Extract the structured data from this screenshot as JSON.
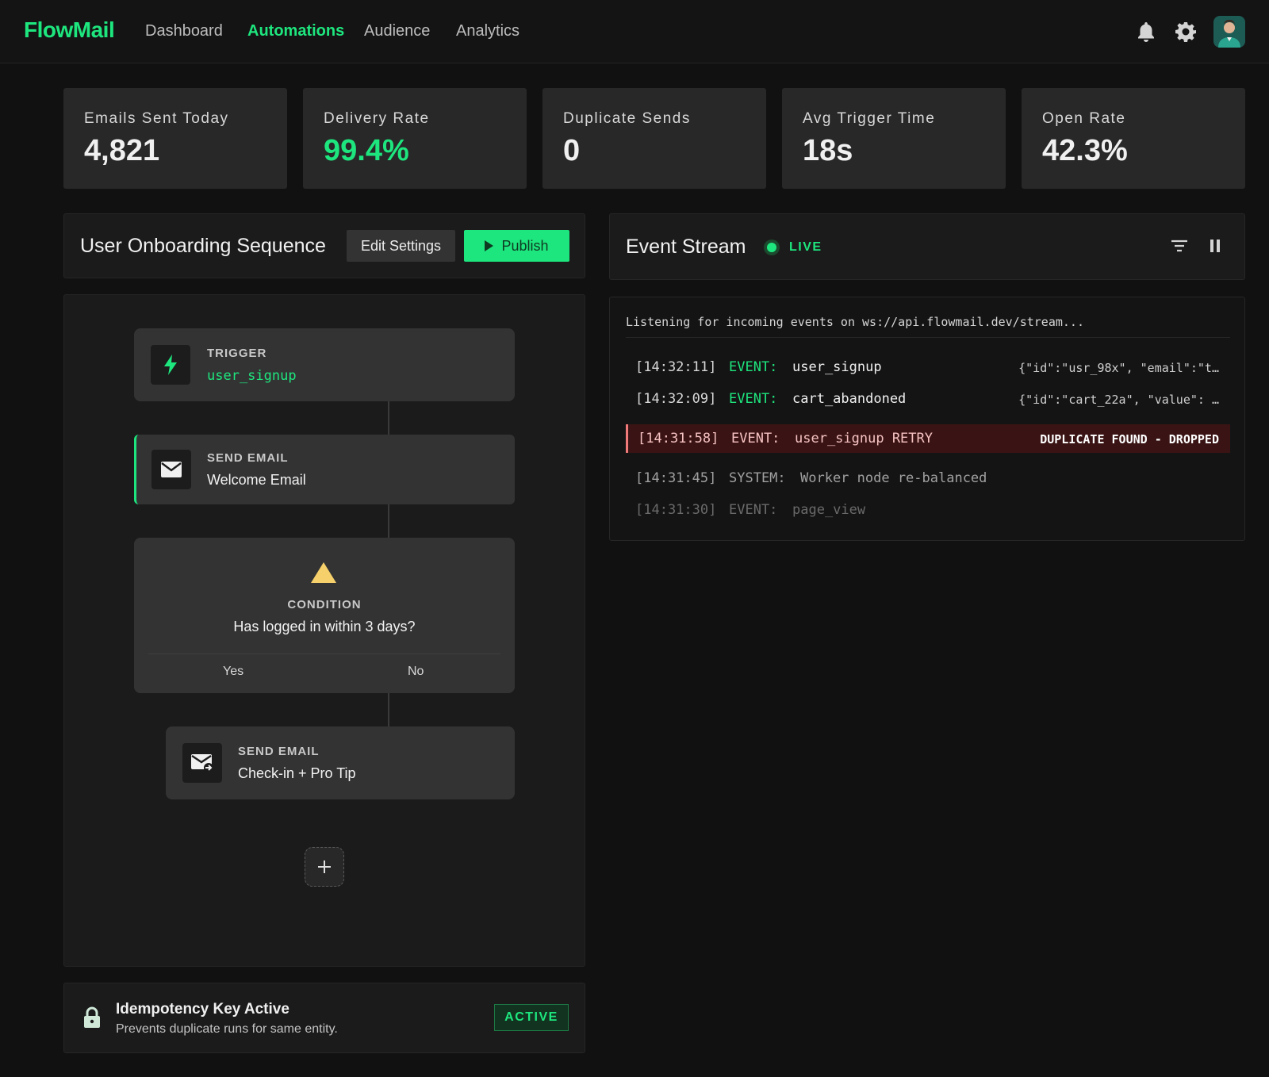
{
  "app": {
    "brand": "FlowMail",
    "nav": [
      {
        "label": "Dashboard",
        "active": false
      },
      {
        "label": "Automations",
        "active": true
      },
      {
        "label": "Audience",
        "active": false
      },
      {
        "label": "Analytics",
        "active": false
      }
    ],
    "icons": [
      "bell-icon",
      "gear-icon",
      "avatar"
    ]
  },
  "colors": {
    "accent": "#1ee67e",
    "background": "#111111",
    "card": "#282828",
    "danger_bg": "#3a1414",
    "warning": "#f5d06b"
  },
  "stats": [
    {
      "label": "Emails Sent Today",
      "value": "4,821",
      "highlight": false
    },
    {
      "label": "Delivery Rate",
      "value": "99.4%",
      "highlight": true
    },
    {
      "label": "Duplicate Sends",
      "value": "0",
      "highlight": false
    },
    {
      "label": "Avg Trigger Time",
      "value": "18s",
      "highlight": false
    },
    {
      "label": "Open Rate",
      "value": "42.3%",
      "highlight": false
    }
  ],
  "workflow": {
    "title": "User Onboarding Sequence",
    "edit_label": "Edit Settings",
    "publish_label": "Publish",
    "nodes": {
      "trigger": {
        "kind": "TRIGGER",
        "name": "user_signup",
        "icon": "lightning-icon"
      },
      "email1": {
        "kind": "SEND EMAIL",
        "name": "Welcome Email",
        "icon": "envelope-icon"
      },
      "condition": {
        "kind": "CONDITION",
        "name": "Has logged in within 3 days?",
        "icon": "warning-icon",
        "yes": "Yes",
        "no": "No"
      },
      "email2": {
        "kind": "SEND EMAIL",
        "name": "Check-in + Pro Tip",
        "icon": "envelope-send-icon"
      }
    },
    "add_icon": "plus-icon"
  },
  "idempotency": {
    "title": "Idempotency Key Active",
    "subtitle": "Prevents duplicate runs for same entity.",
    "badge": "ACTIVE",
    "icon": "lock-icon"
  },
  "event_stream": {
    "title": "Event Stream",
    "status": "LIVE",
    "listening": "Listening for incoming events on ws://api.flowmail.dev/stream...",
    "icons": [
      "filter-icon",
      "pause-icon"
    ],
    "events": [
      {
        "time": "[14:32:11]",
        "type": "EVENT:",
        "name": "user_signup",
        "payload": "{\"id\":\"usr_98x\", \"email\":\"t…"
      },
      {
        "time": "[14:32:09]",
        "type": "EVENT:",
        "name": "cart_abandoned",
        "payload": "{\"id\":\"cart_22a\", \"value\": …"
      },
      {
        "time": "[14:31:58]",
        "type": "EVENT:",
        "name": "user_signup RETRY",
        "payload": "DUPLICATE FOUND - DROPPED"
      },
      {
        "time": "[14:31:45]",
        "type": "SYSTEM:",
        "name": "Worker node re-balanced",
        "payload": ""
      },
      {
        "time": "[14:31:30]",
        "type": "EVENT:",
        "name": "page_view",
        "payload": ""
      }
    ]
  }
}
